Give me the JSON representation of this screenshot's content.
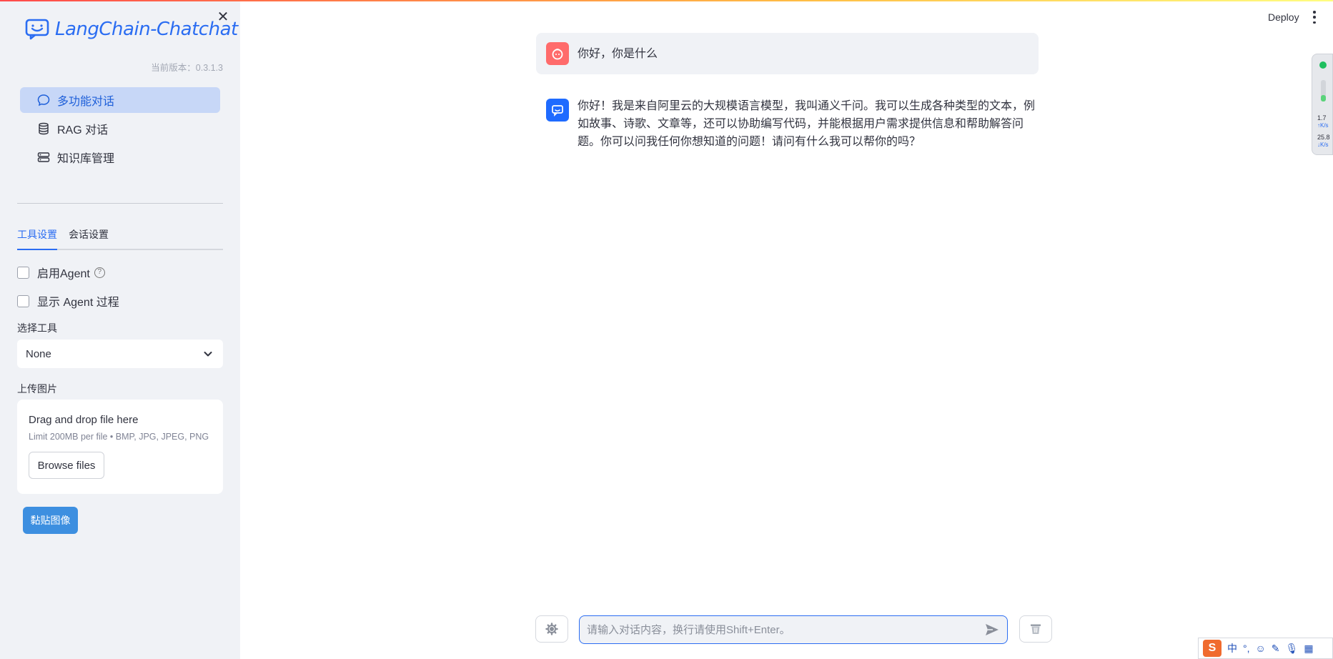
{
  "app": {
    "logo_text": "LangChain-Chatchat",
    "version": "当前版本：0.3.1.3"
  },
  "nav": {
    "items": [
      {
        "label": "多功能对话",
        "icon": "chat-bubble-icon",
        "active": true
      },
      {
        "label": "RAG 对话",
        "icon": "database-icon",
        "active": false
      },
      {
        "label": "知识库管理",
        "icon": "storage-icon",
        "active": false
      }
    ]
  },
  "tabs": [
    {
      "label": "工具设置",
      "active": true
    },
    {
      "label": "会话设置",
      "active": false
    }
  ],
  "tools": {
    "enable_agent_label": "启用Agent",
    "show_agent_process_label": "显示 Agent 过程",
    "select_tool_label": "选择工具",
    "select_tool_value": "None",
    "upload_image_label": "上传图片",
    "uploader_title": "Drag and drop file here",
    "uploader_limit": "Limit 200MB per file • BMP, JPG, JPEG, PNG",
    "browse_label": "Browse files",
    "paste_label": "黏贴图像"
  },
  "header": {
    "deploy_label": "Deploy"
  },
  "chat": {
    "messages": [
      {
        "role": "user",
        "text": "你好，你是什么"
      },
      {
        "role": "assistant",
        "text": "你好！我是来自阿里云的大规模语言模型，我叫通义千问。我可以生成各种类型的文本，例如故事、诗歌、文章等，还可以协助编写代码，并能根据用户需求提供信息和帮助解答问题。你可以问我任何你想知道的问题！请问有什么我可以帮你的吗？"
      }
    ],
    "input_placeholder": "请输入对话内容，换行请使用Shift+Enter。"
  },
  "net_widget": {
    "up_value": "1.7",
    "down_value": "25.8",
    "unit": "K/s"
  },
  "ime": {
    "logo": "S",
    "lang": "中",
    "punct": "°,"
  },
  "colors": {
    "accent": "#2b6df2",
    "sidebar_bg": "#f0f2f6",
    "active_nav_bg": "#c7d7f7",
    "paste_button": "#3d8fe0",
    "user_avatar": "#ff6b6b",
    "bot_avatar": "#1f6bff"
  }
}
